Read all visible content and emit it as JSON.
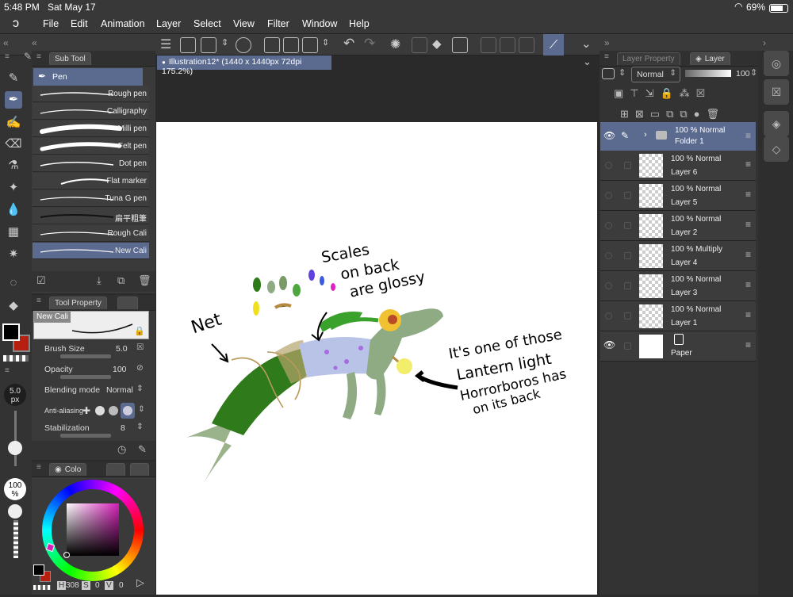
{
  "status": {
    "time": "5:48 PM",
    "date": "Sat May 17",
    "battery": "69%"
  },
  "menu": [
    "File",
    "Edit",
    "Animation",
    "Layer",
    "Select",
    "View",
    "Filter",
    "Window",
    "Help"
  ],
  "subtool": {
    "header": "Sub Tool",
    "group": "Pen",
    "brushes": [
      "Rough pen",
      "Calligraphy",
      "Milli pen",
      "Felt pen",
      "Dot pen",
      "Flat marker",
      "Tuna G pen",
      "扁平粗筆",
      "Rough Cali",
      "New Cali"
    ],
    "selected": "New Cali"
  },
  "toolprop": {
    "header": "Tool Property",
    "preview": "New Cali",
    "brush_size_label": "Brush Size",
    "brush_size_value": "5.0",
    "opacity_label": "Opacity",
    "opacity_value": "100",
    "blend_label": "Blending mode",
    "blend_value": "Normal",
    "aa_label": "Anti-aliasing",
    "stab_label": "Stabilization",
    "stab_value": "8"
  },
  "size_indicator": {
    "value": "5.0",
    "unit": "px"
  },
  "opacity_indicator": {
    "value": "100",
    "unit": "%"
  },
  "color_panel": {
    "tab": "Colo",
    "h": "308",
    "s": "0",
    "v": "0",
    "h_label": "H",
    "s_label": "S",
    "v_label": "V"
  },
  "document": {
    "title": "Illustration12* (1440 x 1440px 72dpi 175.2%)"
  },
  "layer_panel": {
    "tab_prop": "Layer Property",
    "tab_layer": "Layer",
    "blend": "Normal",
    "opacity": "100",
    "layers": [
      {
        "mode": "100 % Normal",
        "name": "Folder 1"
      },
      {
        "mode": "100 % Normal",
        "name": "Layer 6"
      },
      {
        "mode": "100 % Normal",
        "name": "Layer 5"
      },
      {
        "mode": "100 % Normal",
        "name": "Layer 2"
      },
      {
        "mode": "100 % Multiply",
        "name": "Layer 4"
      },
      {
        "mode": "100 % Normal",
        "name": "Layer 3"
      },
      {
        "mode": "100 % Normal",
        "name": "Layer 1"
      },
      {
        "mode": "",
        "name": "Paper"
      }
    ]
  },
  "canvas_text": {
    "net": "Net",
    "scales_1": "Scales",
    "scales_2": "on back",
    "scales_3": "are glossy",
    "lantern_1": "It's one of those",
    "lantern_2": "Lantern light",
    "lantern_3": "Horrorboros has",
    "lantern_4": "on its back"
  },
  "colors": {
    "main": "#000000",
    "sub": "#b52010",
    "accent": "#5b6a8f"
  }
}
